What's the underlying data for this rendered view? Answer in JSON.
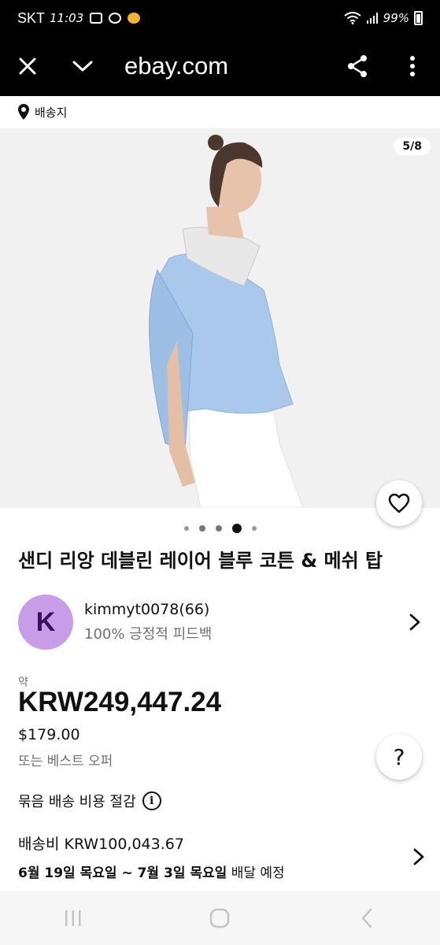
{
  "status": {
    "carrier": "SKT",
    "time": "11:03",
    "battery": "99%"
  },
  "browser": {
    "url": "ebay.com"
  },
  "shipping_location": {
    "label": "배송지"
  },
  "gallery": {
    "counter": "5/8",
    "dots": 5,
    "active_dot": 4
  },
  "product": {
    "title": "샌디 리앙 데블린 레이어 블루 코튼 & 메쉬 탑"
  },
  "seller": {
    "initial": "K",
    "name": "kimmyt0078(66)",
    "feedback": "100% 긍정적 피드백"
  },
  "price": {
    "approx_label": "약",
    "krw": "KRW249,447.24",
    "usd": "$179.00",
    "best_offer": "또는 베스트 오퍼"
  },
  "combined_shipping": {
    "label": "묶음 배송 비용 절감"
  },
  "delivery": {
    "cost": "배송비 KRW100,043.67",
    "date_range": "6월 19일 목요일 ~ 7월 3일 목요일",
    "date_suffix": " 배달 예정"
  },
  "help": {
    "label": "?"
  },
  "colors": {
    "avatar_bg": "#c89de8",
    "avatar_text": "#3a0b63",
    "shirt": "#a9c8ec"
  }
}
